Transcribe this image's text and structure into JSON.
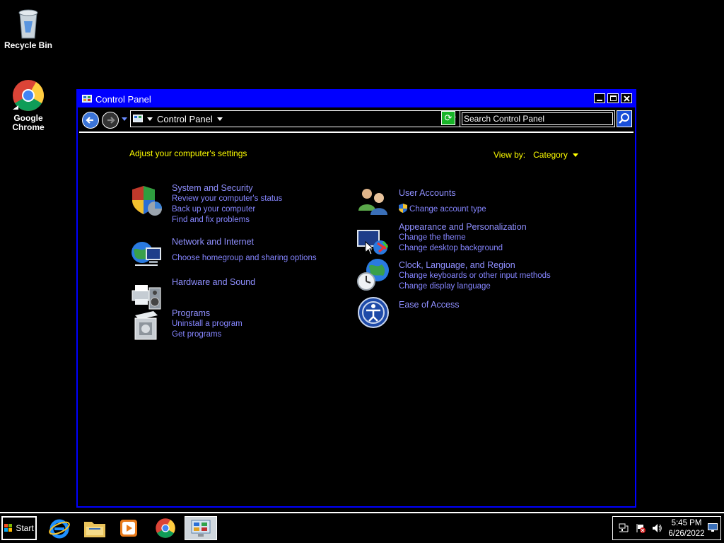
{
  "desktop": {
    "recycle_bin_label": "Recycle Bin",
    "chrome_label_line1": "Google",
    "chrome_label_line2": "Chrome"
  },
  "window": {
    "title": "Control Panel",
    "buttons": {
      "minimize": "_",
      "maximize": "□",
      "close": "✕"
    },
    "address": {
      "location": "Control Panel"
    },
    "search": {
      "placeholder": "Search Control Panel"
    }
  },
  "main": {
    "heading": "Adjust your computer's settings",
    "view_by_label": "View by:",
    "view_by_value": "Category",
    "categories": [
      {
        "title": "System and Security",
        "links": [
          "Review your computer's status",
          "Back up your computer",
          "Find and fix problems"
        ],
        "icon": "shield-icon"
      },
      {
        "title": "Network and Internet",
        "links": [
          "Choose homegroup and sharing options"
        ],
        "icon": "network-globe-icon"
      },
      {
        "title": "Hardware and Sound",
        "links": [],
        "icon": "printer-speaker-icon"
      },
      {
        "title": "Programs",
        "links": [
          "Uninstall a program",
          "Get programs"
        ],
        "icon": "programs-box-icon"
      },
      {
        "title": "User Accounts",
        "links": [
          "Change account type"
        ],
        "icon": "users-icon"
      },
      {
        "title": "Appearance and Personalization",
        "links": [
          "Change the theme",
          "Change desktop background"
        ],
        "icon": "monitor-paint-icon"
      },
      {
        "title": "Clock, Language, and Region",
        "links": [
          "Change keyboards or other input methods",
          "Change display language"
        ],
        "icon": "clock-globe-icon"
      },
      {
        "title": "Ease of Access",
        "links": [],
        "icon": "ease-of-access-icon"
      }
    ]
  },
  "taskbar": {
    "start_label": "Start",
    "clock_time": "5:45 PM",
    "clock_date": "6/26/2022"
  },
  "colors": {
    "window_border": "#0000ff",
    "heading": "#ffff00",
    "link": "#8585ff"
  }
}
